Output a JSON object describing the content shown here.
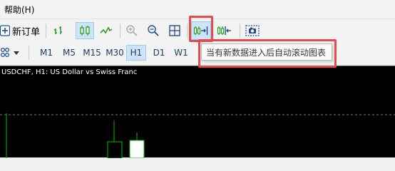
{
  "menu": {
    "help_label": "帮助(H)"
  },
  "toolbar": {
    "new_order_label": "新订单",
    "buttons": [
      {
        "name": "bar-chart-icon"
      },
      {
        "name": "candlestick-chart-icon"
      },
      {
        "name": "line-chart-icon"
      },
      {
        "name": "zoom-in-icon"
      },
      {
        "name": "zoom-out-icon"
      },
      {
        "name": "grid-icon"
      },
      {
        "name": "auto-scroll-icon"
      },
      {
        "name": "chart-shift-icon"
      },
      {
        "name": "screenshot-icon"
      }
    ]
  },
  "timeframes": {
    "items": [
      "M1",
      "M5",
      "M15",
      "M30",
      "H1",
      "D1",
      "W1"
    ],
    "active": "H1"
  },
  "tooltip": {
    "text": "当有新数据进入后自动滚动图表"
  },
  "chart": {
    "title": "USDCHF, H1:  US Dollar vs Swiss Franc"
  },
  "colors": {
    "accent_red": "#e8494a",
    "candle_green": "#00c000",
    "chart_bg": "#000000",
    "active_tf_bg": "#cde4f7"
  }
}
